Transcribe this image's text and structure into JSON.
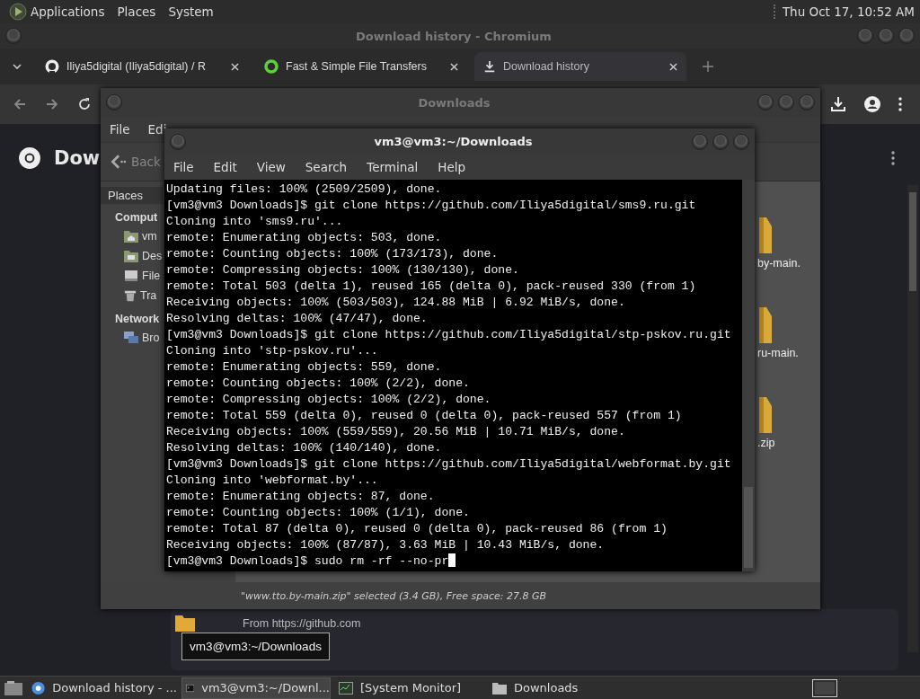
{
  "top_panel": {
    "menus": [
      "Applications",
      "Places",
      "System"
    ],
    "clock": "Thu Oct 17, 10:52 AM"
  },
  "browser": {
    "title": "Download history - Chromium",
    "tabs": [
      {
        "kind": "github",
        "label": "Iliya5digital (Iliya5digital) / R",
        "selected": false
      },
      {
        "kind": "ring",
        "label": "Fast & Simple File Transfers",
        "selected": false
      },
      {
        "kind": "download",
        "label": "Download history",
        "selected": true
      }
    ],
    "page_heading": "Dow",
    "download_source": "From https://github.com"
  },
  "file_manager": {
    "title": "Downloads",
    "menus": [
      "File",
      "Edi"
    ],
    "back_button": "Back",
    "sidebar": [
      {
        "kind": "header",
        "label": "Places"
      },
      {
        "kind": "section",
        "label": "Comput"
      },
      {
        "kind": "home",
        "label": "vm"
      },
      {
        "kind": "desktop",
        "label": "Des"
      },
      {
        "kind": "drive",
        "label": "File"
      },
      {
        "kind": "trash",
        "label": "Tra"
      },
      {
        "kind": "section",
        "label": "Network"
      },
      {
        "kind": "network",
        "label": "Bro"
      }
    ],
    "files": [
      "by-main.",
      "ru-main.",
      ".zip"
    ],
    "status": "\"www.tto.by-main.zip\" selected (3.4 GB), Free space: 27.8 GB"
  },
  "terminal": {
    "title": "vm3@vm3:~/Downloads",
    "menus": [
      "File",
      "Edit",
      "View",
      "Search",
      "Terminal",
      "Help"
    ],
    "lines": [
      "Updating files: 100% (2509/2509), done.",
      "[vm3@vm3 Downloads]$ git clone https://github.com/Iliya5digital/sms9.ru.git",
      "Cloning into 'sms9.ru'...",
      "remote: Enumerating objects: 503, done.",
      "remote: Counting objects: 100% (173/173), done.",
      "remote: Compressing objects: 100% (130/130), done.",
      "remote: Total 503 (delta 1), reused 165 (delta 0), pack-reused 330 (from 1)",
      "Receiving objects: 100% (503/503), 124.88 MiB | 6.92 MiB/s, done.",
      "Resolving deltas: 100% (47/47), done.",
      "[vm3@vm3 Downloads]$ git clone https://github.com/Iliya5digital/stp-pskov.ru.git",
      "Cloning into 'stp-pskov.ru'...",
      "remote: Enumerating objects: 559, done.",
      "remote: Counting objects: 100% (2/2), done.",
      "remote: Compressing objects: 100% (2/2), done.",
      "remote: Total 559 (delta 0), reused 0 (delta 0), pack-reused 557 (from 1)",
      "Receiving objects: 100% (559/559), 20.56 MiB | 10.71 MiB/s, done.",
      "Resolving deltas: 100% (140/140), done.",
      "[vm3@vm3 Downloads]$ git clone https://github.com/Iliya5digital/webformat.by.git",
      "Cloning into 'webformat.by'...",
      "remote: Enumerating objects: 87, done.",
      "remote: Counting objects: 100% (1/1), done.",
      "remote: Total 87 (delta 0), reused 0 (delta 0), pack-reused 86 (from 1)",
      "Receiving objects: 100% (87/87), 3.63 MiB | 10.43 MiB/s, done.",
      "[vm3@vm3 Downloads]$ sudo rm -rf --no-pr"
    ]
  },
  "tooltip": "vm3@vm3:~/Downloads",
  "taskbar": [
    {
      "kind": "browser",
      "label": "Download history - ...",
      "selected": false
    },
    {
      "kind": "terminal",
      "label": "vm3@vm3:~/Downl...",
      "selected": true
    },
    {
      "kind": "monitor",
      "label": "[System Monitor]",
      "selected": false
    },
    {
      "kind": "folder",
      "label": "Downloads",
      "selected": false
    }
  ]
}
